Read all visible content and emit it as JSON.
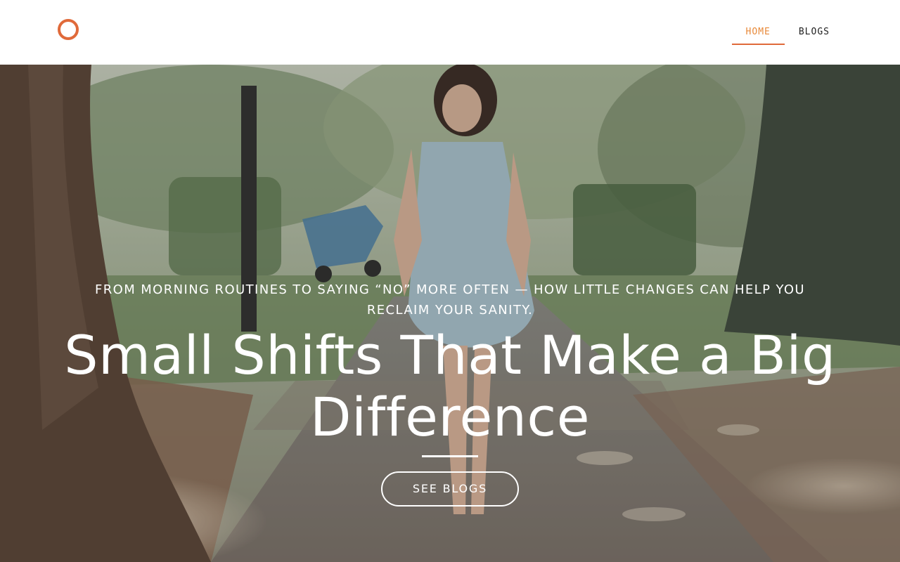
{
  "header": {
    "logo_icon": "ring-logo-icon",
    "nav": [
      {
        "label": "HOME",
        "active": true
      },
      {
        "label": "BLOGS",
        "active": false
      }
    ]
  },
  "hero": {
    "kicker": "FROM MORNING ROUTINES TO SAYING “NO” MORE OFTEN — HOW LITTLE CHANGES CAN HELP YOU RECLAIM YOUR SANITY.",
    "title": "Small Shifts That Make a Big Difference",
    "button_label": "SEE BLOGS"
  },
  "colors": {
    "accent": "#e06a3a",
    "active_nav_text": "#e88a3a",
    "header_bg": "#ffffff",
    "hero_text": "#ffffff"
  }
}
